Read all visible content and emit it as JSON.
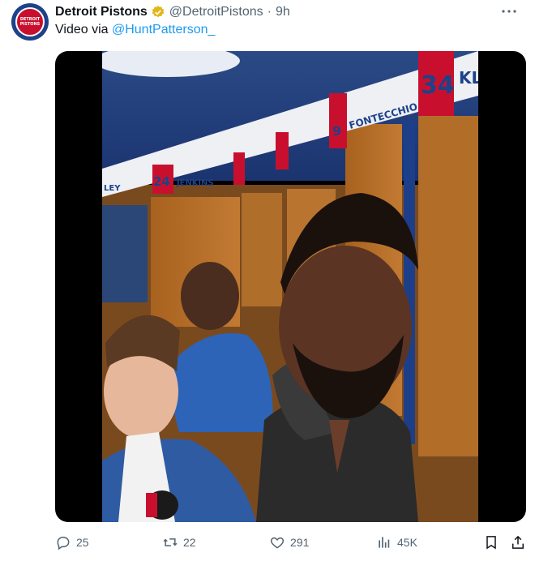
{
  "post": {
    "author_name": "Detroit Pistons",
    "author_handle": "@DetroitPistons",
    "separator": "·",
    "time": "9h",
    "avatar_text_line1": "DETROIT",
    "avatar_text_line2": "PISTONS",
    "text_prefix": "Video via ",
    "mention": "@HuntPatterson_"
  },
  "video": {
    "nameplates": [
      {
        "number": "24",
        "name": "JENKINS"
      },
      {
        "number": "9",
        "name": "FONTECCHIO"
      },
      {
        "number": "34",
        "name": "KL"
      },
      {
        "number": "",
        "name": "LEY"
      }
    ]
  },
  "actions": {
    "replies": "25",
    "reposts": "22",
    "likes": "291",
    "views": "45K"
  },
  "colors": {
    "brand_blue": "#1d428a",
    "brand_red": "#c8102e",
    "link": "#1d9bf0",
    "muted": "#536471"
  },
  "icons": [
    "verified-badge-icon",
    "more-icon",
    "reply-icon",
    "repost-icon",
    "like-icon",
    "views-icon",
    "bookmark-icon",
    "share-icon"
  ]
}
